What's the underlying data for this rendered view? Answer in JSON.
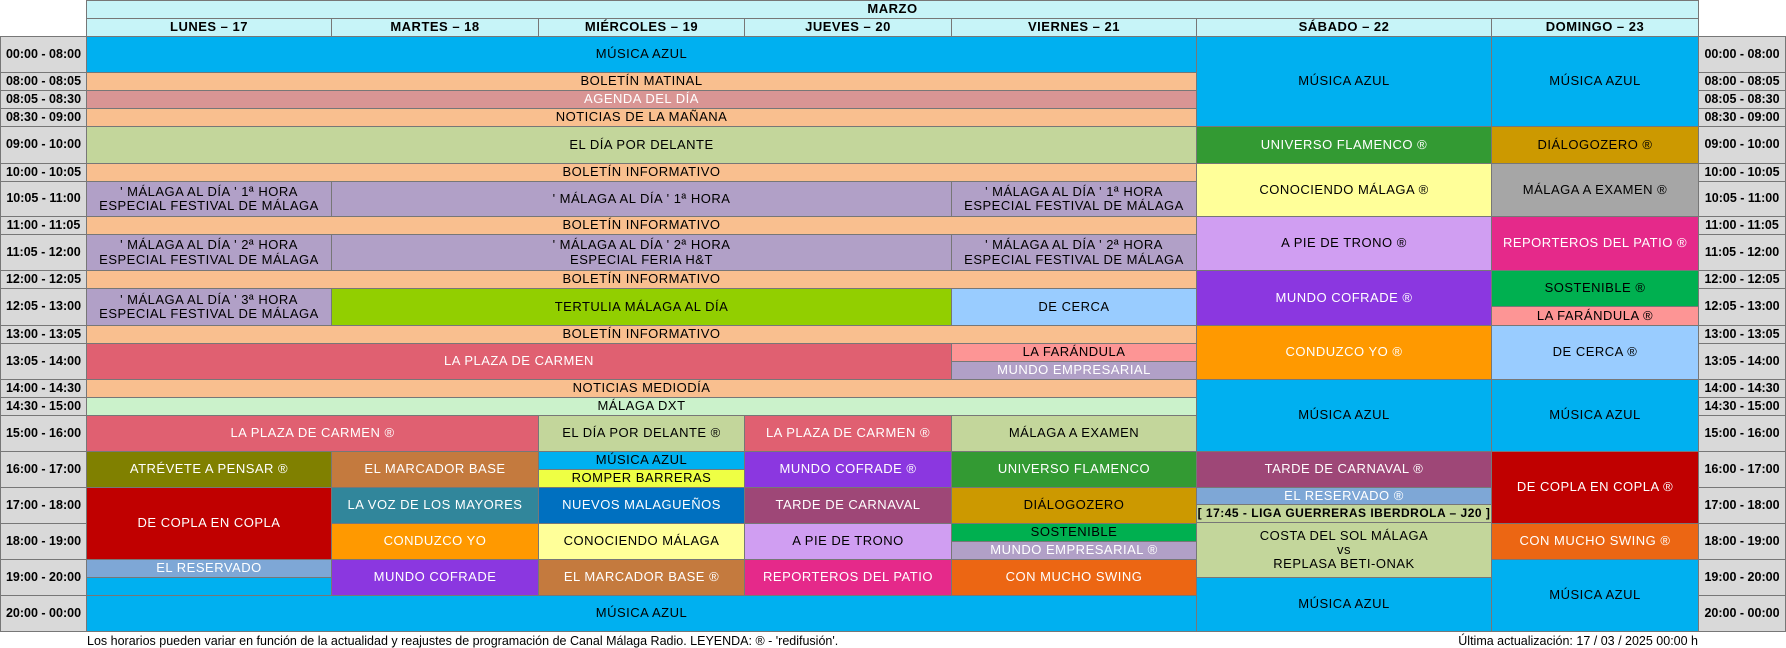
{
  "month": "MARZO",
  "days": [
    "LUNES – 17",
    "MARTES – 18",
    "MIÉRCOLES – 19",
    "JUEVES – 20",
    "VIERNES – 21",
    "SÁBADO – 22",
    "DOMINGO – 23"
  ],
  "times": [
    "00:00 - 08:00",
    "08:00 - 08:05",
    "08:05 - 08:30",
    "08:30 - 09:00",
    "09:00 - 10:00",
    "10:00 - 10:05",
    "10:05 - 11:00",
    "11:00 - 11:05",
    "11:05 - 12:00",
    "12:00 - 12:05",
    "12:05 - 13:00",
    "13:00 - 13:05",
    "13:05 - 14:00",
    "14:00 - 14:30",
    "14:30 - 15:00",
    "15:00 - 16:00",
    "16:00 - 17:00",
    "17:00 - 18:00",
    "18:00 - 19:00",
    "19:00 - 20:00",
    "20:00 - 00:00"
  ],
  "programs": [
    {
      "text": "MÚSICA  AZUL",
      "color": "#00b0f0"
    },
    {
      "text": "BOLETÍN MATINAL",
      "color": "#f9bf8f"
    },
    {
      "text": "AGENDA DEL DÍA",
      "color": "#d99594"
    },
    {
      "text": "NOTICIAS DE LA MAÑANA",
      "color": "#f9bf8f"
    },
    {
      "text": "EL DÍA POR DELANTE",
      "color": "#c3d69b"
    },
    {
      "text": "BOLETÍN INFORMATIVO",
      "color": "#f9bf8f"
    },
    {
      "text": "' MÁLAGA AL DÍA ' 1ª HORA\nESPECIAL FESTIVAL DE MÁLAGA",
      "color": "#b1a0c7"
    },
    {
      "text": "' MÁLAGA AL DÍA ' 1ª HORA",
      "color": "#b1a0c7"
    },
    {
      "text": "' MÁLAGA AL DÍA ' 1ª HORA\nESPECIAL FESTIVAL DE MÁLAGA",
      "color": "#b1a0c7"
    },
    {
      "text": "BOLETÍN INFORMATIVO",
      "color": "#f9bf8f"
    },
    {
      "text": "' MÁLAGA AL DÍA ' 2ª HORA\nESPECIAL FESTIVAL DE MÁLAGA",
      "color": "#b1a0c7"
    },
    {
      "text": "' MÁLAGA AL DÍA ' 2ª HORA\nESPECIAL FERIA H&T",
      "color": "#b1a0c7"
    },
    {
      "text": "' MÁLAGA AL DÍA ' 2ª HORA\nESPECIAL FESTIVAL DE MÁLAGA",
      "color": "#b1a0c7"
    },
    {
      "text": "BOLETÍN INFORMATIVO",
      "color": "#f9bf8f"
    },
    {
      "text": "' MÁLAGA AL DÍA ' 3ª HORA\nESPECIAL FESTIVAL DE MÁLAGA",
      "color": "#b1a0c7"
    },
    {
      "text": "TERTULIA MÁLAGA AL DÍA",
      "color": "#92cf00"
    },
    {
      "text": "DE CERCA",
      "color": "#99ccff"
    },
    {
      "text": "BOLETÍN INFORMATIVO",
      "color": "#f9bf8f"
    },
    {
      "text": "LA PLAZA DE CARMEN",
      "color": "#e06071"
    },
    {
      "text": "LA FARÁNDULA",
      "color": "#fd9595"
    },
    {
      "text": "MUNDO EMPRESARIAL",
      "color": "#b1a0c7"
    },
    {
      "text": "NOTICIAS MEDIODÍA",
      "color": "#f9bf8f"
    },
    {
      "text": "MÁLAGA DXT",
      "color": "#cbf2cb"
    },
    {
      "text": "LA PLAZA DE CARMEN  ®",
      "color": "#e06071"
    },
    {
      "text": "EL DÍA POR DELANTE  ®",
      "color": "#c3d69b"
    },
    {
      "text": "LA PLAZA DE CARMEN  ®",
      "color": "#e06071"
    },
    {
      "text": "MÁLAGA A EXAMEN",
      "color": "#c3d69b"
    },
    {
      "text": "ATRÉVETE  A  PENSAR  ®",
      "color": "#808000"
    },
    {
      "text": "EL MARCADOR BASE",
      "color": "#c47a3e"
    },
    {
      "text": "MÚSICA  AZUL",
      "color": "#00b0f0"
    },
    {
      "text": "ROMPER  BARRERAS",
      "color": "#eeff44"
    },
    {
      "text": "MUNDO COFRADE  ®",
      "color": "#8b37e0"
    },
    {
      "text": "UNIVERSO FLAMENCO",
      "color": "#339a33"
    },
    {
      "text": "DE COPLA EN COPLA",
      "color": "#c00000"
    },
    {
      "text": "LA VOZ DE LOS MAYORES",
      "color": "#31869b"
    },
    {
      "text": "NUEVOS MALAGUEÑOS",
      "color": "#0070c0"
    },
    {
      "text": "TARDE DE CARNAVAL",
      "color": "#9e4777"
    },
    {
      "text": "DIÁLOGOZERO",
      "color": "#cc9900"
    },
    {
      "text": "CONDUZCO YO",
      "color": "#ff9900"
    },
    {
      "text": "CONOCIENDO MÁLAGA",
      "color": "#ffff99"
    },
    {
      "text": "A PIE DE TRONO",
      "color": "#d09ef2"
    },
    {
      "text": "SOSTENIBLE",
      "color": "#00b050"
    },
    {
      "text": "MUNDO EMPRESARIAL  ®",
      "color": "#b1a0c7"
    },
    {
      "text": "EL RESERVADO",
      "color": "#7ea7d6"
    },
    {
      "text": "MUNDO COFRADE",
      "color": "#8b37e0"
    },
    {
      "text": "EL MARCADOR BASE  ®",
      "color": "#c47a3e"
    },
    {
      "text": "REPORTEROS DEL PATIO",
      "color": "#e5298a"
    },
    {
      "text": "CON MUCHO SWING",
      "color": "#ec6613"
    },
    {
      "text": "MÚSICA  AZUL",
      "color": "#00b0f0"
    },
    {
      "text": "MÚSICA  AZUL",
      "color": "#00b0f0"
    },
    {
      "text": "UNIVERSO FLAMENCO  ®",
      "color": "#339a33"
    },
    {
      "text": "CONOCIENDO MÁLAGA  ®",
      "color": "#ffff99"
    },
    {
      "text": "A PIE DE TRONO  ®",
      "color": "#d09ef2"
    },
    {
      "text": "MUNDO COFRADE  ®",
      "color": "#8b37e0"
    },
    {
      "text": "CONDUZCO YO  ®",
      "color": "#ff9900"
    },
    {
      "text": "MÚSICA  AZUL",
      "color": "#00b0f0"
    },
    {
      "text": "TARDE DE CARNAVAL  ®",
      "color": "#9e4777"
    },
    {
      "text": "EL RESERVADO  ®",
      "color": "#7ea7d6"
    },
    {
      "text": "[ 17:45 - LIGA GUERRERAS IBERDROLA – J20 ]",
      "color": "#c3d69b"
    },
    {
      "text": "COSTA DEL SOL MÁLAGA\nvs\nREPLASA BETI-ONAK",
      "color": "#c3d69b"
    },
    {
      "text": "MÚSICA  AZUL",
      "color": "#00b0f0"
    },
    {
      "text": "MÚSICA  AZUL",
      "color": "#00b0f0"
    },
    {
      "text": "DIÁLOGOZERO  ®",
      "color": "#cc9900"
    },
    {
      "text": "MÁLAGA A EXAMEN  ®",
      "color": "#a6a6a6"
    },
    {
      "text": "REPORTEROS DEL PATIO  ®",
      "color": "#e5298a"
    },
    {
      "text": "SOSTENIBLE  ®",
      "color": "#00b050"
    },
    {
      "text": "LA FARÁNDULA  ®",
      "color": "#fd9595"
    },
    {
      "text": "DE CERCA  ®",
      "color": "#99ccff"
    },
    {
      "text": "MÚSICA  AZUL",
      "color": "#00b0f0"
    },
    {
      "text": "DE COPLA EN COPLA  ®",
      "color": "#c00000"
    },
    {
      "text": "CON MUCHO SWING  ®",
      "color": "#ec6613"
    },
    {
      "text": "MÚSICA  AZUL",
      "color": "#00b0f0"
    }
  ],
  "footer": {
    "note": "Los horarios pueden variar en función de la actualidad y reajustes de programación de Canal Málaga Radio.  LEYENDA: ® - 'redifusión'.",
    "updated": "Última actualización:  17 / 03 / 2025   00:00 h"
  }
}
